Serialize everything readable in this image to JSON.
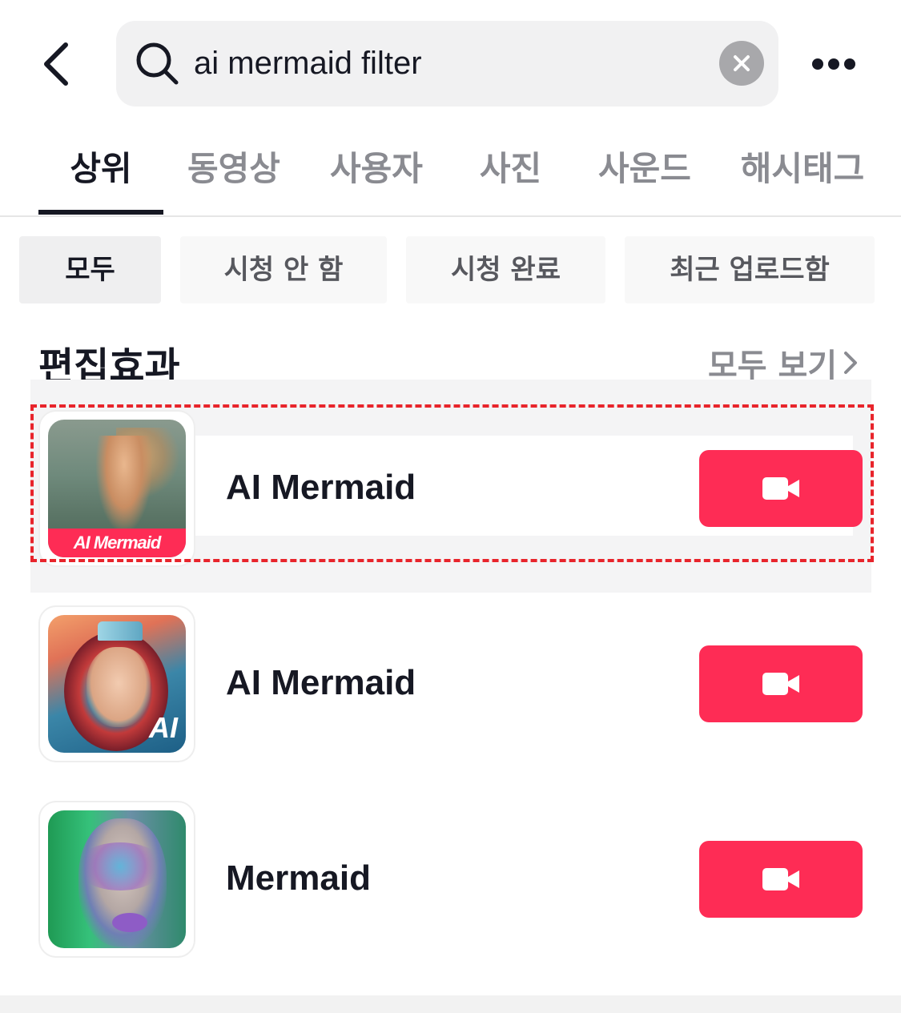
{
  "search": {
    "query": "ai mermaid filter"
  },
  "tabs": [
    {
      "label": "상위",
      "active": true
    },
    {
      "label": "동영상",
      "active": false
    },
    {
      "label": "사용자",
      "active": false
    },
    {
      "label": "사진",
      "active": false
    },
    {
      "label": "사운드",
      "active": false
    },
    {
      "label": "해시태그",
      "active": false
    }
  ],
  "chips": [
    {
      "label": "모두",
      "active": true
    },
    {
      "label": "시청 안 함",
      "active": false
    },
    {
      "label": "시청 완료",
      "active": false
    },
    {
      "label": "최근 업로드함",
      "active": false
    }
  ],
  "section": {
    "title": "편집효과",
    "see_all": "모두 보기"
  },
  "effects": [
    {
      "name": "AI Mermaid",
      "thumb_label": "AI Mermaid",
      "highlighted": true
    },
    {
      "name": "AI Mermaid",
      "thumb_label": "AI",
      "highlighted": false
    },
    {
      "name": "Mermaid",
      "thumb_label": "",
      "highlighted": false
    }
  ],
  "colors": {
    "accent": "#fe2c55",
    "highlight_border": "#e8242b",
    "text_primary": "#161823",
    "text_secondary": "#8a8b91"
  },
  "icons": {
    "back": "chevron-left-icon",
    "search": "search-icon",
    "clear": "clear-icon",
    "more": "more-icon",
    "see_all": "chevron-right-icon",
    "camera": "video-camera-icon"
  }
}
